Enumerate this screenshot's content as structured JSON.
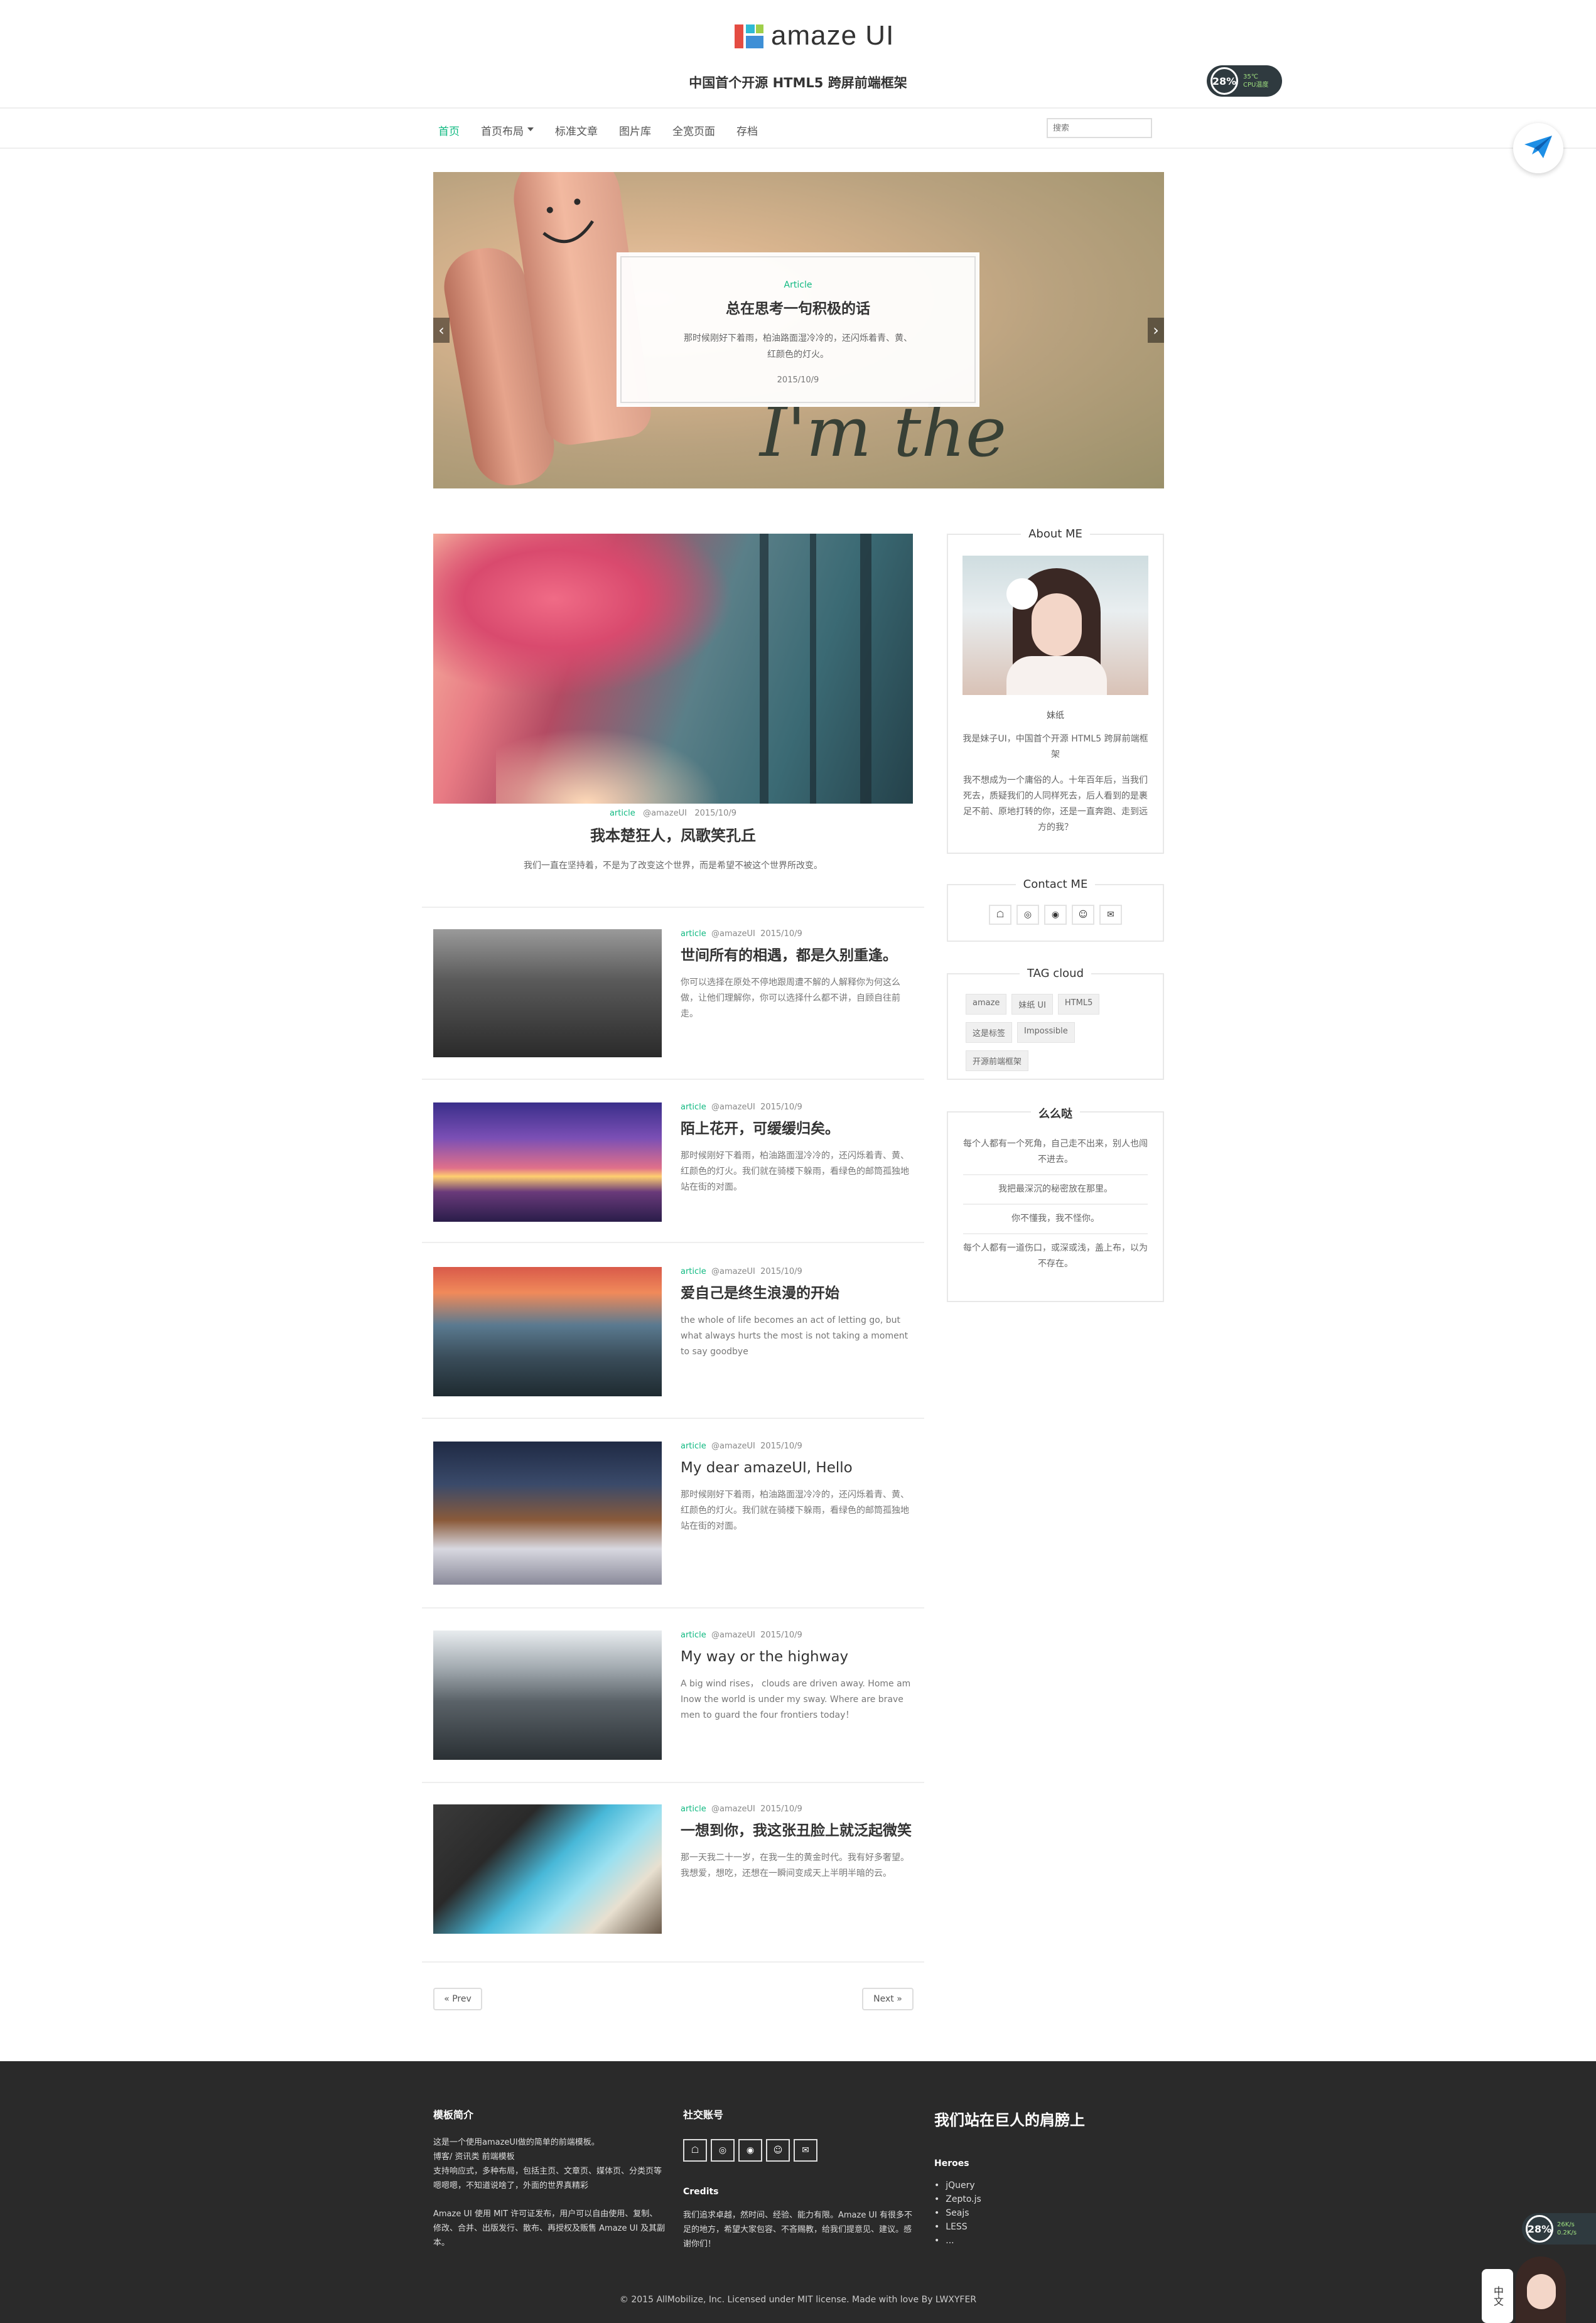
{
  "header": {
    "logo_text": "amaze UI",
    "slogan": "中国首个开源 HTML5 跨屏前端框架",
    "widget": {
      "percent": "28%",
      "temp": "35℃",
      "cpu_label": "CPU温度"
    }
  },
  "nav": {
    "items": [
      {
        "label": "首页",
        "active": true
      },
      {
        "label": "首页布局",
        "dropdown": true
      },
      {
        "label": "标准文章"
      },
      {
        "label": "图片库"
      },
      {
        "label": "全宽页面"
      },
      {
        "label": "存档"
      }
    ],
    "search_placeholder": "搜索"
  },
  "slider": {
    "tag": "Article",
    "title": "总在思考一句积极的话",
    "desc": "那时候刚好下着雨，柏油路面湿冷冷的，还闪烁着青、黄、红颜色的灯火。",
    "date": "2015/10/9",
    "scribble": "I'm the young",
    "prev": "‹",
    "next": "›"
  },
  "featured": {
    "category": "article",
    "author": "@amazeUI",
    "date": "2015/10/9",
    "title": "我本楚狂人，凤歌笑孔丘",
    "desc": "我们一直在坚持着，不是为了改变这个世界，而是希望不被这个世界所改变。"
  },
  "posts": [
    {
      "category": "article",
      "author": "@amazeUI",
      "date": "2015/10/9",
      "title": "世间所有的相遇，都是久别重逢。",
      "desc": "你可以选择在原处不停地跟周遭不解的人解释你为何这么做，让他们理解你，你可以选择什么都不讲，自顾自往前走。"
    },
    {
      "category": "article",
      "author": "@amazeUI",
      "date": "2015/10/9",
      "title": "陌上花开，可缓缓归矣。",
      "desc": "那时候刚好下着雨，柏油路面湿冷冷的，还闪烁着青、黄、红颜色的灯火。我们就在骑楼下躲雨，看绿色的邮筒孤独地站在街的对面。"
    },
    {
      "category": "article",
      "author": "@amazeUI",
      "date": "2015/10/9",
      "title": "爱自己是终生浪漫的开始",
      "desc": "the whole of life becomes an act of letting go, but what always hurts the most is not taking a moment to say goodbye"
    },
    {
      "category": "article",
      "author": "@amazeUI",
      "date": "2015/10/9",
      "title": "My dear amazeUI, Hello",
      "desc": "那时候刚好下着雨，柏油路面湿冷冷的，还闪烁着青、黄、红颜色的灯火。我们就在骑楼下躲雨，看绿色的邮筒孤独地站在街的对面。"
    },
    {
      "category": "article",
      "author": "@amazeUI",
      "date": "2015/10/9",
      "title": "My way or the highway",
      "desc": "A big wind rises， clouds are driven away. Home am Inow the world is under my sway. Where are brave men to guard the four frontiers today！"
    },
    {
      "category": "article",
      "author": "@amazeUI",
      "date": "2015/10/9",
      "title": "一想到你，我这张丑脸上就泛起微笑",
      "desc": "那一天我二十一岁，在我一生的黄金时代。我有好多奢望。我想爱，想吃，还想在一瞬间变成天上半明半暗的云。"
    }
  ],
  "pager": {
    "prev": "« Prev",
    "next": "Next »"
  },
  "sidebar": {
    "about": {
      "title": "About ME",
      "name": "妹纸",
      "intro": "我是妹子UI，中国首个开源 HTML5 跨屏前端框架",
      "text": "我不想成为一个庸俗的人。十年百年后，当我们死去，质疑我们的人同样死去，后人看到的是裹足不前、原地打转的你，还是一直奔跑、走到远方的我？"
    },
    "contact": {
      "title": "Contact ME",
      "icons": [
        "☖",
        "◎",
        "◉",
        "☺",
        "✉"
      ]
    },
    "tags": {
      "title": "TAG cloud",
      "items": [
        "amaze",
        "妹纸 UI",
        "HTML5",
        "这是标签",
        "Impossible",
        "开源前端框架"
      ]
    },
    "mmd": {
      "title": "么么哒",
      "items": [
        "每个人都有一个死角，自己走不出来，别人也闯不进去。",
        "我把最深沉的秘密放在那里。",
        "你不懂我，我不怪你。",
        "每个人都有一道伤口，或深或浅，盖上布，以为不存在。"
      ]
    }
  },
  "footer": {
    "col1": {
      "title": "模板简介",
      "lines": [
        "这是一个使用amazeUI做的简单的前端模板。",
        "博客/ 资讯类 前端模板",
        "支持响应式，多种布局，包括主页、文章页、媒体页、分类页等",
        "嗯嗯嗯，不知道说啥了，外面的世界真精彩"
      ],
      "license": "Amaze UI 使用 MIT 许可证发布，用户可以自由使用、复制、修改、合并、出版发行、散布、再授权及贩售 Amaze UI 及其副本。"
    },
    "col2": {
      "title": "社交账号",
      "icons": [
        "☖",
        "◎",
        "◉",
        "☺",
        "✉"
      ],
      "credits_title": "Credits",
      "credits": "我们追求卓越，然时间、经验、能力有限。Amaze UI 有很多不足的地方，希望大家包容、不吝赐教，给我们提意见、建议。感谢你们！"
    },
    "col3": {
      "title": "我们站在巨人的肩膀上",
      "heroes_title": "Heroes",
      "heroes": [
        "jQuery",
        "Zepto.js",
        "Seajs",
        "LESS",
        "..."
      ]
    },
    "copyright": "© 2015 AllMobilize, Inc. Licensed under MIT license. Made with love By LWXYFER",
    "widget": {
      "percent": "28%",
      "up": "26K/s",
      "down": "0.2K/s"
    },
    "mascot_text": "中文"
  }
}
